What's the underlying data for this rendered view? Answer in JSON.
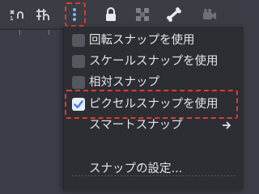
{
  "toolbar": {
    "icons": [
      "ruler-icon",
      "grid-snap-icon",
      "more-options-icon",
      "lock-icon",
      "group-icon",
      "bone-icon",
      "camera-icon"
    ]
  },
  "snap_menu": {
    "items": [
      {
        "label": "回転スナップを使用",
        "checked": false
      },
      {
        "label": "スケールスナップを使用",
        "checked": false
      },
      {
        "label": "相対スナップ",
        "checked": false
      },
      {
        "label": "ピクセルスナップを使用",
        "checked": true
      },
      {
        "label": "スマートスナップ",
        "submenu": true
      },
      {
        "label": "スナップの設定..."
      }
    ]
  },
  "colors": {
    "accent_check": "#3d7fe6",
    "highlight_dash": "#e0392e",
    "menu_bg": "#2c2e33",
    "text": "#e3e5e8"
  }
}
